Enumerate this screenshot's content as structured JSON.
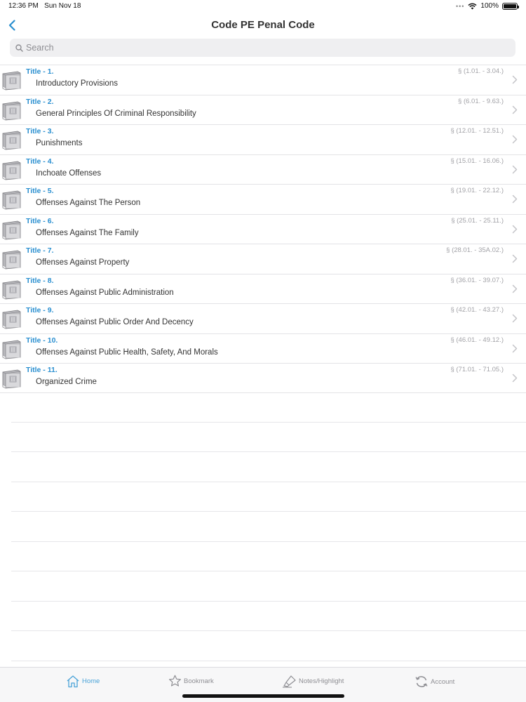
{
  "status": {
    "time": "12:36 PM",
    "date": "Sun Nov 18",
    "battery": "100%",
    "battery_level": 1.0
  },
  "nav": {
    "title": "Code PE Penal Code",
    "back_icon": "chevron-left-icon"
  },
  "search": {
    "placeholder": "Search",
    "value": ""
  },
  "titles": [
    {
      "title": "Title - 1.",
      "name": "Introductory Provisions",
      "range": "§ (1.01. - 3.04.)"
    },
    {
      "title": "Title - 2.",
      "name": "General Principles Of Criminal Responsibility",
      "range": "§ (6.01. - 9.63.)"
    },
    {
      "title": "Title - 3.",
      "name": "Punishments",
      "range": "§ (12.01. - 12.51.)"
    },
    {
      "title": "Title - 4.",
      "name": "Inchoate Offenses",
      "range": "§ (15.01. - 16.06.)"
    },
    {
      "title": "Title - 5.",
      "name": "Offenses Against The Person",
      "range": "§ (19.01. - 22.12.)"
    },
    {
      "title": "Title - 6.",
      "name": "Offenses Against The Family",
      "range": "§ (25.01. - 25.11.)"
    },
    {
      "title": "Title - 7.",
      "name": "Offenses Against Property",
      "range": "§ (28.01. - 35A.02.)"
    },
    {
      "title": "Title - 8.",
      "name": "Offenses Against Public Administration",
      "range": "§ (36.01. - 39.07.)"
    },
    {
      "title": "Title - 9.",
      "name": "Offenses Against Public Order And Decency",
      "range": "§ (42.01. - 43.27.)"
    },
    {
      "title": "Title - 10.",
      "name": "Offenses Against Public Health, Safety, And Morals",
      "range": "§ (46.01. - 49.12.)"
    },
    {
      "title": "Title - 11.",
      "name": "Organized Crime",
      "range": "§ (71.01. - 71.05.)"
    }
  ],
  "tabs": [
    {
      "label": "Home",
      "icon": "home-icon",
      "active": true
    },
    {
      "label": "Bookmark",
      "icon": "star-icon",
      "active": false
    },
    {
      "label": "Notes/Highlight",
      "icon": "highlighter-icon",
      "active": false
    },
    {
      "label": "Account",
      "icon": "refresh-icon",
      "active": false
    }
  ],
  "colors": {
    "accent": "#2a8fd0",
    "tab_active": "#4aa3d8",
    "tab_inactive": "#8e8e93"
  }
}
